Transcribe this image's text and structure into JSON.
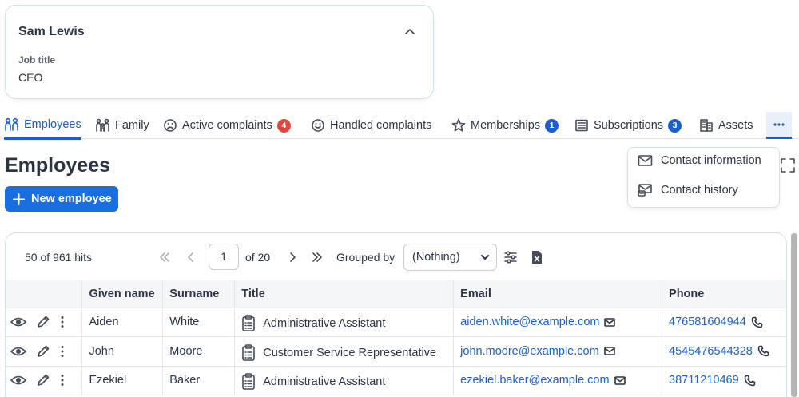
{
  "profile": {
    "name": "Sam Lewis",
    "job_title_label": "Job title",
    "job_title_value": "CEO"
  },
  "tabs": [
    {
      "label": "Employees",
      "icon": "employees-icon",
      "active": true
    },
    {
      "label": "Family",
      "icon": "family-icon"
    },
    {
      "label": "Active complaints",
      "icon": "frown-icon",
      "badge": "4",
      "badge_color": "#e0473f"
    },
    {
      "label": "Handled complaints",
      "icon": "smile-icon"
    },
    {
      "label": "Memberships",
      "icon": "star-icon",
      "badge": "1",
      "badge_color": "#1a5fd0"
    },
    {
      "label": "Subscriptions",
      "icon": "newspaper-icon",
      "badge": "3",
      "badge_color": "#1a5fd0"
    },
    {
      "label": "Assets",
      "icon": "building-icon"
    }
  ],
  "more_menu": {
    "items": [
      {
        "label": "Contact information",
        "icon": "envelope-icon"
      },
      {
        "label": "Contact history",
        "icon": "contact-history-icon"
      }
    ]
  },
  "page": {
    "title": "Employees",
    "new_button_label": "New employee"
  },
  "grid": {
    "hits": "50 of 961 hits",
    "current_page": "1",
    "of_pages": "of 20",
    "grouped_by_label": "Grouped by",
    "grouped_by_value": "(Nothing)",
    "columns": [
      "Given name",
      "Surname",
      "Title",
      "Email",
      "Phone"
    ],
    "rows": [
      {
        "given": "Aiden",
        "surname": "White",
        "title": "Administrative Assistant",
        "email": "aiden.white@example.com",
        "phone": "476581604944"
      },
      {
        "given": "John",
        "surname": "Moore",
        "title": "Customer Service Representative",
        "email": "john.moore@example.com",
        "phone": "4545476544328"
      },
      {
        "given": "Ezekiel",
        "surname": "Baker",
        "title": "Administrative Assistant",
        "email": "ezekiel.baker@example.com",
        "phone": "38711210469"
      }
    ]
  },
  "colors": {
    "accent": "#1a5fd0",
    "button": "#1a6fe0",
    "badge_red": "#e0473f",
    "border": "#cfe3e5"
  }
}
